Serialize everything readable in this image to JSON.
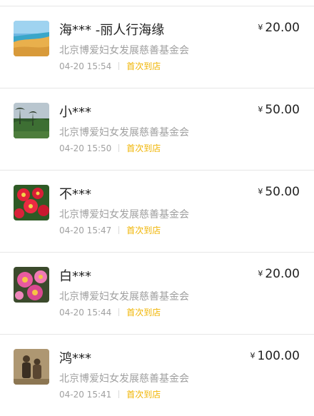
{
  "currency_symbol": "¥",
  "colors": {
    "tag": "#f0b400",
    "muted": "#a0a0a0",
    "text": "#222222",
    "divider": "#e6e6e6"
  },
  "donations": [
    {
      "name": "海*** -丽人行海缘",
      "amount": "20.00",
      "org": "北京博爱妇女发展慈善基金会",
      "time": "04-20 15:54",
      "tag": "首次到店",
      "avatar": "beach-photo"
    },
    {
      "name": "小***",
      "amount": "50.00",
      "org": "北京博爱妇女发展慈善基金会",
      "time": "04-20 15:50",
      "tag": "首次到店",
      "avatar": "palm-landscape-photo"
    },
    {
      "name": "不***",
      "amount": "50.00",
      "org": "北京博爱妇女发展慈善基金会",
      "time": "04-20 15:47",
      "tag": "首次到店",
      "avatar": "red-flowers-photo"
    },
    {
      "name": "白***",
      "amount": "20.00",
      "org": "北京博爱妇女发展慈善基金会",
      "time": "04-20 15:44",
      "tag": "首次到店",
      "avatar": "pink-flower-photo"
    },
    {
      "name": "鸿***",
      "amount": "100.00",
      "org": "北京博爱妇女发展慈善基金会",
      "time": "04-20 15:41",
      "tag": "首次到店",
      "avatar": "vintage-family-photo"
    }
  ]
}
